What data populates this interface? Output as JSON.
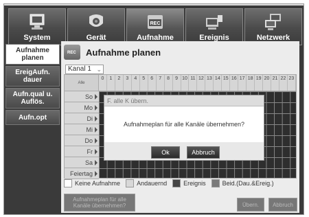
{
  "menu": [
    {
      "label": "System",
      "icon": "monitor-icon"
    },
    {
      "label": "Gerät",
      "icon": "camera-icon"
    },
    {
      "label": "Aufnahme",
      "icon": "rec-icon"
    },
    {
      "label": "Ereignis",
      "icon": "event-icon"
    },
    {
      "label": "Netzwerk",
      "icon": "network-icon"
    }
  ],
  "side": [
    {
      "label": "Aufnahme planen"
    },
    {
      "label": "EreigAufn. dauer"
    },
    {
      "label": "Aufn.qual u. Auflös."
    },
    {
      "label": "Aufn.opt"
    }
  ],
  "panel": {
    "title": "Aufnahme planen",
    "icon_label": "REC",
    "channel": "Kanal 1",
    "header_corner": "Alle",
    "hours": [
      "0",
      "1",
      "2",
      "3",
      "4",
      "5",
      "6",
      "7",
      "8",
      "9",
      "10",
      "11",
      "12",
      "13",
      "14",
      "15",
      "16",
      "17",
      "18",
      "19",
      "20",
      "21",
      "22",
      "23"
    ],
    "days": [
      "So",
      "Mo",
      "Di",
      "Mi",
      "Do",
      "Fr",
      "Sa",
      "Feiertag"
    ]
  },
  "dialog": {
    "title": "F. alle K übern.",
    "message": "Aufnahmeplan für alle Kanäle übernehmen?",
    "ok": "Ok",
    "cancel": "Abbruch"
  },
  "legend": [
    {
      "label": "Keine Aufnahme",
      "color": "#ffffff"
    },
    {
      "label": "Andauernd",
      "color": "#d8d8d8"
    },
    {
      "label": "Ereignis",
      "color": "#444444"
    },
    {
      "label": "Beid.(Dau.&Ereig.)",
      "color": "#7a7a7a"
    }
  ],
  "bottom": {
    "apply_all": "Aufnahmeplan für alle Kanäle übernehmen?",
    "apply": "Übern.",
    "cancel": "Abbruch"
  }
}
